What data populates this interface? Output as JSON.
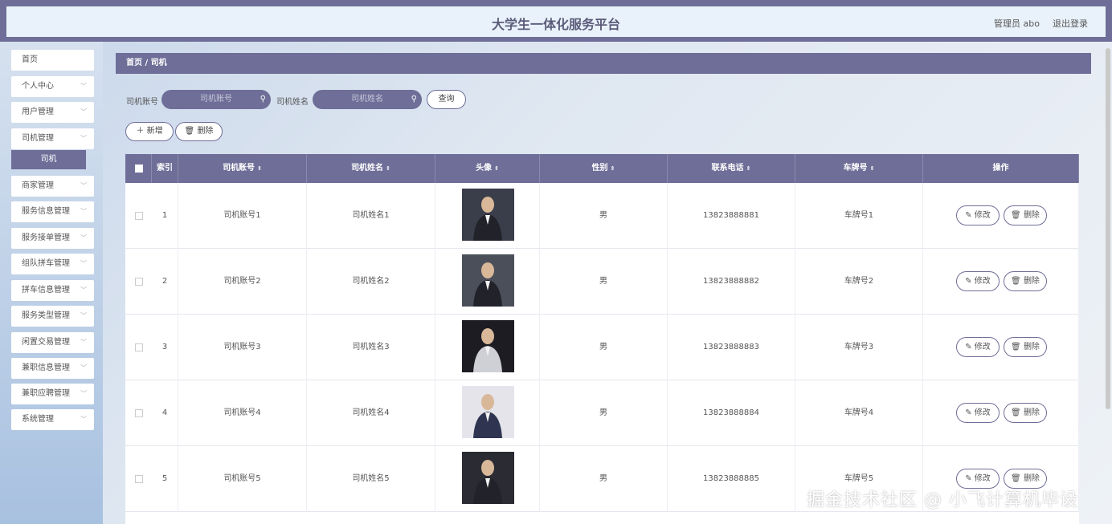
{
  "header": {
    "title": "大学生一体化服务平台",
    "user_label": "管理员 abo",
    "logout_label": "退出登录"
  },
  "sidebar": {
    "items": [
      {
        "label": "首页",
        "has_chevron": false
      },
      {
        "label": "个人中心",
        "has_chevron": true
      },
      {
        "label": "用户管理",
        "has_chevron": true
      },
      {
        "label": "司机管理",
        "has_chevron": true
      },
      {
        "label": "商家管理",
        "has_chevron": true
      },
      {
        "label": "服务信息管理",
        "has_chevron": true
      },
      {
        "label": "服务接单管理",
        "has_chevron": true
      },
      {
        "label": "组队拼车管理",
        "has_chevron": true
      },
      {
        "label": "拼车信息管理",
        "has_chevron": true
      },
      {
        "label": "服务类型管理",
        "has_chevron": true
      },
      {
        "label": "闲置交易管理",
        "has_chevron": true
      },
      {
        "label": "兼职信息管理",
        "has_chevron": true
      },
      {
        "label": "兼职应聘管理",
        "has_chevron": true
      },
      {
        "label": "系统管理",
        "has_chevron": true
      }
    ],
    "active_submenu": "司机"
  },
  "breadcrumb": "首页 / 司机",
  "search": {
    "account_label": "司机账号",
    "account_placeholder": "司机账号",
    "name_label": "司机姓名",
    "name_placeholder": "司机姓名",
    "query_button": "查询"
  },
  "actions": {
    "add_label": "＋ 新增",
    "delete_label": "删除"
  },
  "table": {
    "columns": [
      "索引",
      "司机账号",
      "司机姓名",
      "头像",
      "性别",
      "联系电话",
      "车牌号",
      "操作"
    ],
    "sort_icon": "⇕",
    "edit_label": "修改",
    "delete_label": "删除",
    "rows": [
      {
        "index": "1",
        "account": "司机账号1",
        "name": "司机姓名1",
        "gender": "男",
        "phone": "13823888881",
        "plate": "车牌号1"
      },
      {
        "index": "2",
        "account": "司机账号2",
        "name": "司机姓名2",
        "gender": "男",
        "phone": "13823888882",
        "plate": "车牌号2"
      },
      {
        "index": "3",
        "account": "司机账号3",
        "name": "司机姓名3",
        "gender": "男",
        "phone": "13823888883",
        "plate": "车牌号3"
      },
      {
        "index": "4",
        "account": "司机账号4",
        "name": "司机姓名4",
        "gender": "男",
        "phone": "13823888884",
        "plate": "车牌号4"
      },
      {
        "index": "5",
        "account": "司机账号5",
        "name": "司机姓名5",
        "gender": "男",
        "phone": "13823888885",
        "plate": "车牌号5"
      }
    ]
  },
  "watermark": "掘金技术社区 @ 小飞计算机毕设",
  "colors": {
    "accent": "#6e6e98",
    "header_bg": "#e9f2fa"
  }
}
